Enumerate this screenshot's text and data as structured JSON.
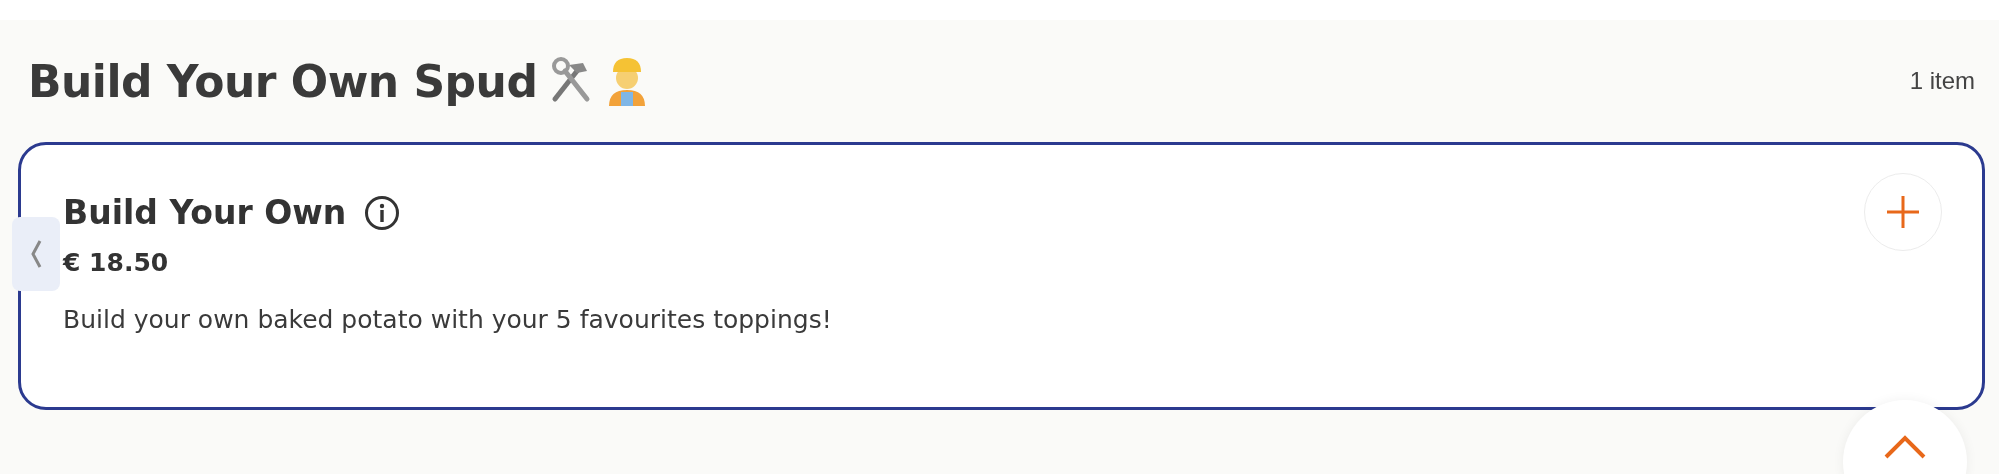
{
  "section": {
    "title": "Build Your Own Spud",
    "count": "1 item"
  },
  "items": [
    {
      "name": "Build Your Own",
      "price": "€ 18.50",
      "description": "Build your own baked potato with your 5 favourites toppings!"
    }
  ]
}
